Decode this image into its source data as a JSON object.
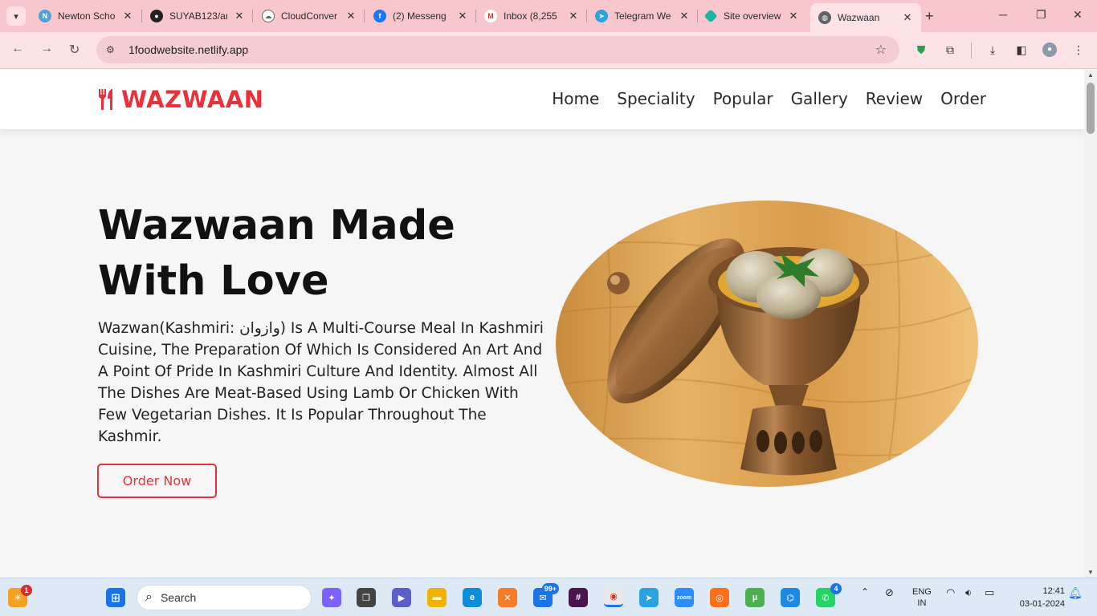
{
  "browser": {
    "tabs": [
      {
        "title": "Newton Scho",
        "icon": "newton-icon",
        "color": "#4da3d8"
      },
      {
        "title": "SUYAB123/ar",
        "icon": "github-icon",
        "color": "#222222"
      },
      {
        "title": "CloudConver",
        "icon": "cloud-icon",
        "color": "#666666"
      },
      {
        "title": "(2) Messeng",
        "icon": "facebook-icon",
        "color": "#1877f2"
      },
      {
        "title": "Inbox (8,255",
        "icon": "gmail-icon",
        "color": "#d93025"
      },
      {
        "title": "Telegram We",
        "icon": "telegram-icon",
        "color": "#2aa3e0"
      },
      {
        "title": "Site overview",
        "icon": "netlify-icon",
        "color": "#1bb5a5"
      },
      {
        "title": "Wazwaan",
        "icon": "globe-icon",
        "color": "#5f6368"
      }
    ],
    "url": "1foodwebsite.netlify.app"
  },
  "site": {
    "logo_text": "WAZWAAN",
    "nav": [
      "Home",
      "Speciality",
      "Popular",
      "Gallery",
      "Review",
      "Order"
    ],
    "hero": {
      "title": "Wazwaan Made With Love",
      "text": "Wazwan(Kashmiri: وازوان) Is A Multi-Course Meal In Kashmiri Cuisine, The Preparation Of Which Is Considered An Art And A Point Of Pride In Kashmiri Culture And Identity. Almost All The Dishes Are Meat-Based Using Lamb Or Chicken With Few Vegetarian Dishes. It Is Popular Throughout The Kashmir.",
      "button": "Order Now"
    },
    "accent_color": "#e8313b"
  },
  "taskbar": {
    "search_label": "Search",
    "notification_badge": "1",
    "mail_badge": "99+",
    "whatsapp_badge": "4",
    "language": "ENG",
    "region": "IN",
    "time": "12:41",
    "date": "03-01-2024"
  }
}
